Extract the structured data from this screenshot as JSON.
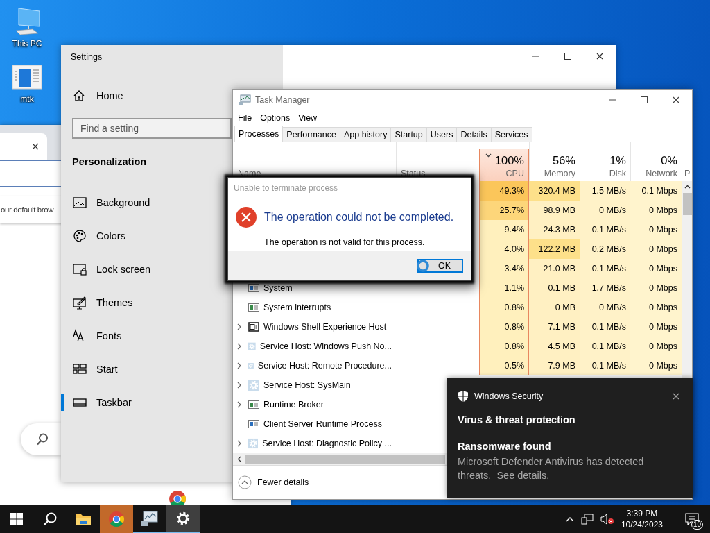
{
  "desktop": {
    "icons": [
      {
        "label": "This PC",
        "kind": "computer"
      },
      {
        "label": "mtk",
        "kind": "document"
      }
    ]
  },
  "browser": {
    "suggestion": "our default brow"
  },
  "settings": {
    "title": "Settings",
    "home": "Home",
    "search": {
      "placeholder": "Find a setting"
    },
    "section": "Personalization",
    "items": [
      {
        "label": "Background",
        "kind": "background",
        "selected": false
      },
      {
        "label": "Colors",
        "kind": "colors",
        "selected": false
      },
      {
        "label": "Lock screen",
        "kind": "lock",
        "selected": false
      },
      {
        "label": "Themes",
        "kind": "themes",
        "selected": false
      },
      {
        "label": "Fonts",
        "kind": "fonts",
        "selected": false
      },
      {
        "label": "Start",
        "kind": "start",
        "selected": false
      },
      {
        "label": "Taskbar",
        "kind": "taskbar",
        "selected": true
      }
    ]
  },
  "task_manager": {
    "title": "Task Manager",
    "menu": [
      "File",
      "Options",
      "View"
    ],
    "tabs": [
      {
        "label": "Processes",
        "selected": true
      },
      {
        "label": "Performance",
        "selected": false
      },
      {
        "label": "App history",
        "selected": false
      },
      {
        "label": "Startup",
        "selected": false
      },
      {
        "label": "Users",
        "selected": false
      },
      {
        "label": "Details",
        "selected": false
      },
      {
        "label": "Services",
        "selected": false
      }
    ],
    "columns": [
      {
        "label": "Name",
        "sorted": false
      },
      {
        "label": "Status",
        "sorted": false
      },
      {
        "percent": "100%",
        "label": "CPU",
        "sorted": true
      },
      {
        "percent": "56%",
        "label": "Memory",
        "sorted": false
      },
      {
        "percent": "1%",
        "label": "Disk",
        "sorted": false
      },
      {
        "percent": "0%",
        "label": "Network",
        "sorted": false
      },
      {
        "label": "P",
        "sorted": false
      }
    ],
    "rows": [
      {
        "cpu": "49.3%",
        "memory": "320.4 MB",
        "disk": "1.5 MB/s",
        "network": "0.1 Mbps"
      },
      {
        "cpu": "25.7%",
        "memory": "98.9 MB",
        "disk": "0 MB/s",
        "network": "0 Mbps"
      },
      {
        "cpu": "9.4%",
        "memory": "24.3 MB",
        "disk": "0.1 MB/s",
        "network": "0 Mbps"
      },
      {
        "cpu": "4.0%",
        "memory": "122.2 MB",
        "disk": "0.2 MB/s",
        "network": "0 Mbps"
      },
      {
        "cpu": "3.4%",
        "memory": "21.0 MB",
        "disk": "0.1 MB/s",
        "network": "0 Mbps"
      },
      {
        "name": "System",
        "kind": "system",
        "expandable": false,
        "cpu": "1.1%",
        "memory": "0.1 MB",
        "disk": "1.7 MB/s",
        "network": "0 Mbps"
      },
      {
        "name": "System interrupts",
        "kind": "window",
        "expandable": false,
        "cpu": "0.8%",
        "memory": "0 MB",
        "disk": "0 MB/s",
        "network": "0 Mbps"
      },
      {
        "name": "Windows Shell Experience Host",
        "kind": "shell",
        "expandable": true,
        "cpu": "0.8%",
        "memory": "7.1 MB",
        "disk": "0.1 MB/s",
        "network": "0 Mbps"
      },
      {
        "name": "Service Host: Windows Push No...",
        "kind": "service",
        "expandable": true,
        "cpu": "0.8%",
        "memory": "4.5 MB",
        "disk": "0.1 MB/s",
        "network": "0 Mbps"
      },
      {
        "name": "Service Host: Remote Procedure...",
        "kind": "service",
        "expandable": true,
        "cpu": "0.5%",
        "memory": "7.9 MB",
        "disk": "0.1 MB/s",
        "network": "0 Mbps"
      },
      {
        "name": "Service Host: SysMain",
        "kind": "service",
        "expandable": true
      },
      {
        "name": "Runtime Broker",
        "kind": "window",
        "expandable": true
      },
      {
        "name": "Client Server Runtime Process",
        "kind": "system",
        "expandable": false
      },
      {
        "name": "Service Host: Diagnostic Policy ...",
        "kind": "service",
        "expandable": true
      }
    ],
    "fewer_details": "Fewer details"
  },
  "dialog": {
    "title": "Unable to terminate process",
    "heading": "The operation could not be completed.",
    "message": "The operation is not valid for this process.",
    "button": "OK"
  },
  "notification": {
    "app": "Windows Security",
    "title": "Virus & threat protection",
    "heading": "Ransomware found",
    "body": "Microsoft Defender Antivirus has detected threats.  See details."
  },
  "taskbar": {
    "apps": [
      {
        "kind": "explorer",
        "running": false,
        "active": false,
        "flashing": false
      },
      {
        "kind": "chrome",
        "running": false,
        "active": false,
        "flashing": true
      },
      {
        "kind": "taskmgr",
        "running": true,
        "active": false,
        "flashing": false
      },
      {
        "kind": "settings",
        "running": true,
        "active": true,
        "flashing": false
      }
    ],
    "time": "3:39 PM",
    "date": "10/24/2023",
    "notifications": "10"
  }
}
